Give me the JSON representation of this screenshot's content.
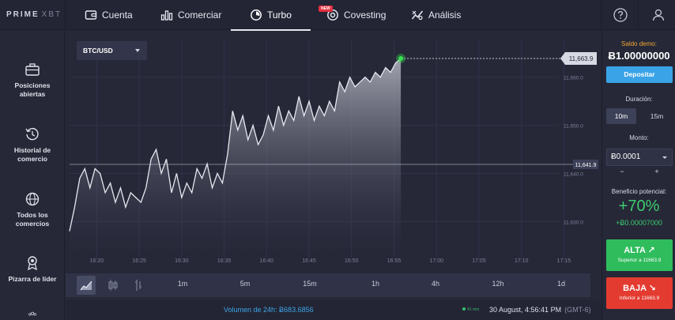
{
  "brand": {
    "logo": "PRIME",
    "logo_sub": "XBT"
  },
  "nav": {
    "tabs": [
      {
        "label": "Cuenta",
        "icon": "wallet-icon"
      },
      {
        "label": "Comerciar",
        "icon": "bar-chart-icon"
      },
      {
        "label": "Turbo",
        "icon": "timer-icon",
        "active": true
      },
      {
        "label": "Covesting",
        "icon": "covesting-icon",
        "badge": "NEW"
      },
      {
        "label": "Análisis",
        "icon": "analysis-icon"
      }
    ],
    "help_icon": "question-circle-icon",
    "user_icon": "user-icon"
  },
  "sidebar": {
    "items": [
      {
        "label_line1": "Posiciones",
        "label_line2": "abiertas",
        "icon": "briefcase-icon"
      },
      {
        "label_line1": "Historial de",
        "label_line2": "comercio",
        "icon": "history-icon"
      },
      {
        "label_line1": "Todos los",
        "label_line2": "comercios",
        "icon": "globe-icon"
      },
      {
        "label_line1": "Pizarra de líder",
        "label_line2": "",
        "icon": "medal-icon"
      }
    ]
  },
  "chart": {
    "pair": "BTC/USD",
    "current_price_label": "11,663.9",
    "strike_price_label": "11,641.9"
  },
  "chart_data": {
    "type": "line",
    "x_ticks": [
      "16:20",
      "16:25",
      "16:30",
      "16:35",
      "16:40",
      "16:45",
      "16:50",
      "16:55",
      "17:00",
      "17:05",
      "17:10",
      "17:15"
    ],
    "y_ticks": [
      {
        "label": "11,660.0",
        "value": 11660
      },
      {
        "label": "11,650.0",
        "value": 11650
      },
      {
        "label": "11,640.0",
        "value": 11640
      },
      {
        "label": "11,630.0",
        "value": 11630
      }
    ],
    "ylim": [
      11624,
      11668
    ],
    "xlim": [
      16.28,
      17.24
    ],
    "current_price": 11663.9,
    "strike_price": 11641.9,
    "series": [
      {
        "x": [
          16.28,
          16.29,
          16.3,
          16.31,
          16.32,
          16.33,
          16.34,
          16.35,
          16.36,
          16.37,
          16.38,
          16.39,
          16.4,
          16.41,
          16.42,
          16.43,
          16.44,
          16.45,
          16.46,
          16.47,
          16.48,
          16.49,
          16.5,
          16.51,
          16.52,
          16.53,
          16.54,
          16.55,
          16.56,
          16.57,
          16.58,
          16.59,
          16.6,
          16.61,
          16.62,
          16.63,
          16.64,
          16.65,
          16.66,
          16.67,
          16.68,
          16.69,
          16.7,
          16.71,
          16.72,
          16.73,
          16.74,
          16.75,
          16.76,
          16.77,
          16.78,
          16.79,
          16.8,
          16.81,
          16.82,
          16.83,
          16.84,
          16.85,
          16.86,
          16.87,
          16.88,
          16.89,
          16.9,
          16.91,
          16.92,
          16.93
        ],
        "values": [
          11628,
          11633,
          11639,
          11641,
          11637,
          11641,
          11640,
          11636,
          11638,
          11634,
          11637,
          11633,
          11636,
          11635,
          11634,
          11637,
          11643,
          11645,
          11640,
          11643,
          11636,
          11640,
          11635,
          11638,
          11636,
          11641,
          11639,
          11642,
          11637,
          11640,
          11638,
          11644,
          11653,
          11649,
          11652,
          11647,
          11650,
          11646,
          11648,
          11652,
          11649,
          11654,
          11650,
          11653,
          11651,
          11656,
          11652,
          11655,
          11651,
          11654,
          11652,
          11655,
          11653,
          11659,
          11657,
          11660,
          11658,
          11659,
          11660,
          11659,
          11661,
          11660,
          11662,
          11661,
          11663,
          11663.9
        ]
      }
    ],
    "grid": true
  },
  "timeframes": {
    "chart_types": [
      "area-chart-icon",
      "candlestick-icon",
      "bars-icon"
    ],
    "options": [
      "1m",
      "5m",
      "15m",
      "1h",
      "4h",
      "12h",
      "1d"
    ]
  },
  "status": {
    "volume": "Volumen de 24h: Ƀ683.6856",
    "online": "41 mm",
    "datetime": "30 August, 4:56:41 PM",
    "timezone": "(GMT-6)"
  },
  "panel": {
    "demo_label": "Saldo demo:",
    "balance": "Ƀ1.00000000",
    "deposit_label": "Depositar",
    "duration_label": "Duración:",
    "durations": [
      {
        "label": "10m",
        "active": true
      },
      {
        "label": "15m",
        "active": false
      }
    ],
    "amount_label": "Monto:",
    "amount_value": "Ƀ0.0001",
    "minus": "−",
    "plus": "+",
    "profit_label": "Beneficio potencial:",
    "profit_pct": "+70%",
    "profit_amount": "+Ƀ0.00007000",
    "up_label": "ALTA ↗",
    "up_sub": "Superior a 11663.9",
    "down_label": "BAJA ↘",
    "down_sub": "Inferior a 11663.9"
  },
  "colors": {
    "accent_blue": "#3aa3e8",
    "up_green": "#2fbc5c",
    "down_red": "#e33b30",
    "demo_orange": "#f0a532",
    "price_dot": "#38e04f"
  }
}
